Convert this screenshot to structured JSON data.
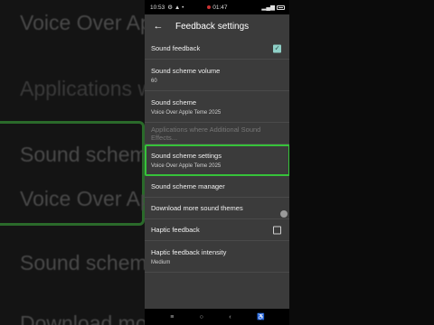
{
  "background": {
    "lines": [
      "Voice Over Apple",
      "Applications w           sound Effects..",
      "Sound scheme",
      "Voice Over Apple",
      "Sound scheme",
      "Download more"
    ]
  },
  "status_bar": {
    "time": "10:53",
    "center_time": "01:47",
    "icons": [
      "wifi-icon",
      "signal-icon",
      "battery-icon"
    ]
  },
  "app_bar": {
    "title": "Feedback settings",
    "back_icon": "arrow-left-icon"
  },
  "settings": {
    "items": [
      {
        "title": "Sound feedback",
        "checked": true
      },
      {
        "title": "Sound scheme volume",
        "sub": "60"
      },
      {
        "title": "Sound scheme",
        "sub": "Voice Over Apple Teme 2025"
      },
      {
        "title": "Applications where Additional Sound Effects..."
      },
      {
        "title": "Sound scheme settings",
        "sub": "Voice Over Apple Teme 2025"
      },
      {
        "title": "Sound scheme manager"
      },
      {
        "title": "Download more sound themes"
      },
      {
        "title": "Haptic feedback",
        "checked": false
      },
      {
        "title": "Haptic feedback intensity",
        "sub": "Medium"
      }
    ]
  },
  "nav_bar": {
    "recents": "≡",
    "home": "○",
    "back": "‹",
    "accessibility": "♿"
  },
  "colors": {
    "highlight": "#36c33a",
    "checkbox_checked": "#8fd0c7",
    "panel": "#3b3b3b"
  }
}
